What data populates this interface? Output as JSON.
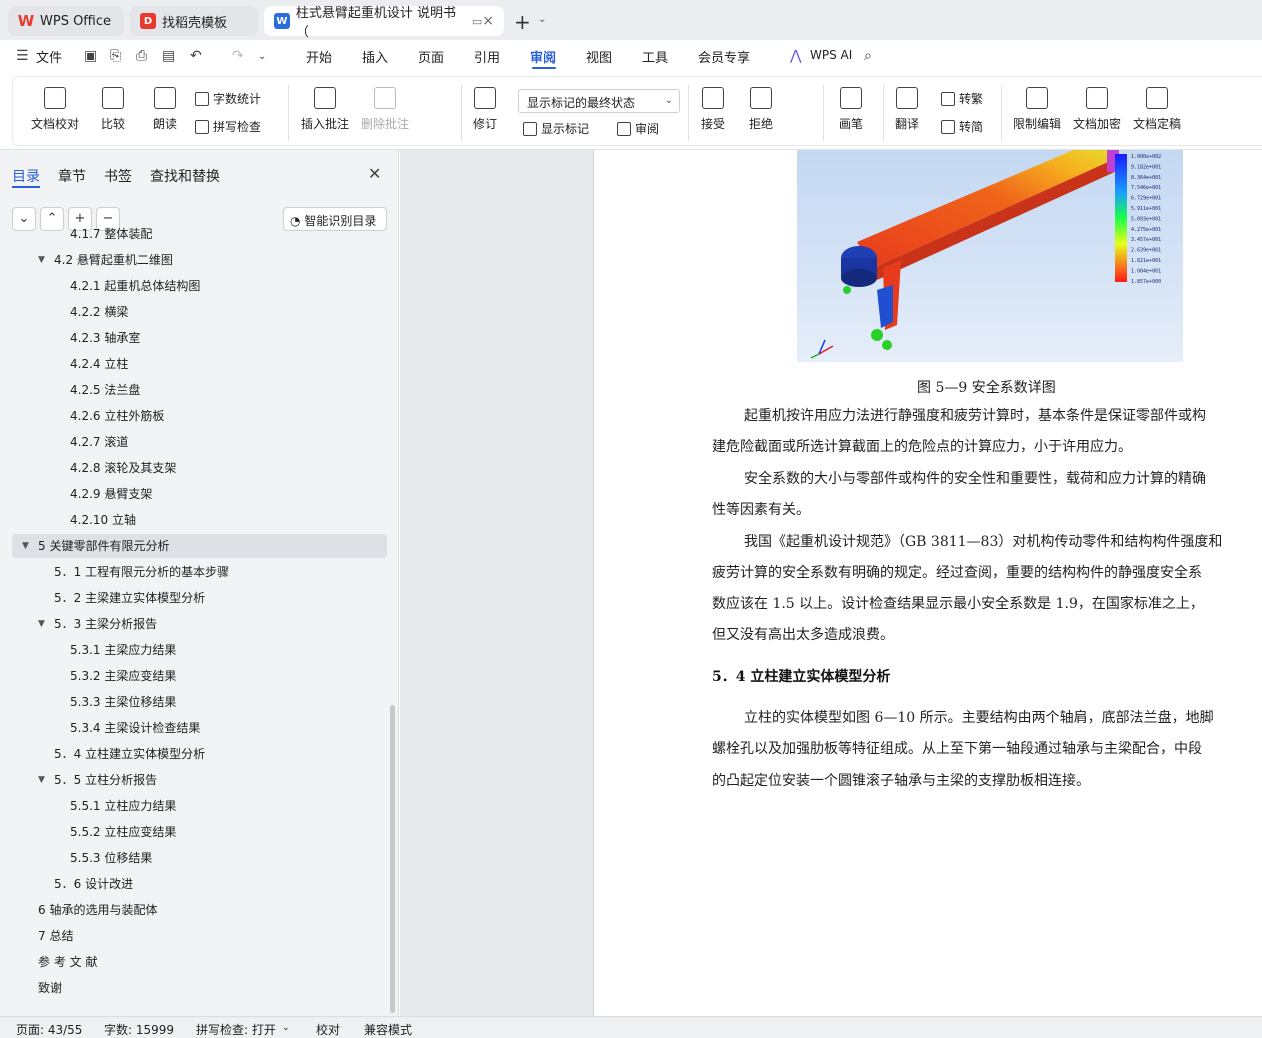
{
  "tabs": {
    "wps": "WPS Office",
    "templates": "找稻壳模板",
    "document": "柱式悬臂起重机设计 说明书（",
    "close": "×",
    "new_tab": "+"
  },
  "menu": {
    "file": "文件",
    "items": [
      "开始",
      "插入",
      "页面",
      "引用",
      "审阅",
      "视图",
      "工具",
      "会员专享"
    ],
    "active": "审阅",
    "wps_ai": "WPS AI"
  },
  "ribbon": {
    "proofread": "文档校对",
    "compare": "比较",
    "read_aloud": "朗读",
    "word_count": "字数统计",
    "spell_check": "拼写检查",
    "insert_comment": "插入批注",
    "delete_comment": "删除批注",
    "track": "修订",
    "markup_state": "显示标记的最终状态",
    "show_markup": "显示标记",
    "review": "审阅",
    "accept": "接受",
    "reject": "拒绝",
    "pen": "画笔",
    "translate": "翻译",
    "to_traditional": "转繁",
    "to_simplified": "转简",
    "restrict_edit": "限制编辑",
    "encrypt": "文档加密",
    "finalize": "文档定稿"
  },
  "sidebar": {
    "tabs": [
      "目录",
      "章节",
      "书签",
      "查找和替换"
    ],
    "smart_toc": "智能识别目录",
    "toc": [
      {
        "text": "4.1.7 整体装配",
        "indent": 3,
        "caret": false
      },
      {
        "text": "4.2   悬臂起重机二维图",
        "indent": 2,
        "caret": true
      },
      {
        "text": "4.2.1 起重机总体结构图",
        "indent": 3,
        "caret": false
      },
      {
        "text": "4.2.2 横梁",
        "indent": 3,
        "caret": false
      },
      {
        "text": "4.2.3 轴承室",
        "indent": 3,
        "caret": false
      },
      {
        "text": "4.2.4 立柱",
        "indent": 3,
        "caret": false
      },
      {
        "text": "4.2.5 法兰盘",
        "indent": 3,
        "caret": false
      },
      {
        "text": "4.2.6 立柱外筋板",
        "indent": 3,
        "caret": false
      },
      {
        "text": "4.2.7 滚道",
        "indent": 3,
        "caret": false
      },
      {
        "text": "4.2.8 滚轮及其支架",
        "indent": 3,
        "caret": false
      },
      {
        "text": "4.2.9 悬臂支架",
        "indent": 3,
        "caret": false
      },
      {
        "text": "4.2.10 立轴",
        "indent": 3,
        "caret": false
      },
      {
        "text": "5   关键零部件有限元分析",
        "indent": 1,
        "caret": true,
        "active": true
      },
      {
        "text": "5．1   工程有限元分析的基本步骤",
        "indent": 2,
        "caret": false
      },
      {
        "text": "5．2   主梁建立实体模型分析",
        "indent": 2,
        "caret": false
      },
      {
        "text": "5．3   主梁分析报告",
        "indent": 2,
        "caret": true
      },
      {
        "text": "5.3.1   主梁应力结果",
        "indent": 3,
        "caret": false
      },
      {
        "text": "5.3.2   主梁应变结果",
        "indent": 3,
        "caret": false
      },
      {
        "text": "5.3.3   主梁位移结果",
        "indent": 3,
        "caret": false
      },
      {
        "text": "5.3.4   主梁设计检查结果",
        "indent": 3,
        "caret": false
      },
      {
        "text": "5．4   立柱建立实体模型分析",
        "indent": 2,
        "caret": false
      },
      {
        "text": "5．5   立柱分析报告",
        "indent": 2,
        "caret": true
      },
      {
        "text": "5.5.1   立柱应力结果",
        "indent": 3,
        "caret": false
      },
      {
        "text": "5.5.2   立柱应变结果",
        "indent": 3,
        "caret": false
      },
      {
        "text": "5.5.3   位移结果",
        "indent": 3,
        "caret": false
      },
      {
        "text": "5．6   设计改进",
        "indent": 2,
        "caret": false
      },
      {
        "text": "6   轴承的选用与装配体",
        "indent": 1,
        "caret": false
      },
      {
        "text": "7   总结",
        "indent": 1,
        "caret": false
      },
      {
        "text": "参 考 文 献",
        "indent": 1,
        "caret": false
      },
      {
        "text": "致谢",
        "indent": 1,
        "caret": false
      }
    ]
  },
  "document": {
    "legend_values": [
      "1.000e+002",
      "9.182e+001",
      "8.364e+001",
      "7.546e+001",
      "6.729e+001",
      "5.911e+001",
      "5.093e+001",
      "4.275e+001",
      "3.457e+001",
      "2.639e+001",
      "1.821e+001",
      "1.004e+001",
      "1.857e+000"
    ],
    "caption": "图 5—9   安全系数详图",
    "para1_l1": "起重机按许用应力法进行静强度和疲劳计算时，基本条件是保证零部件或构",
    "para1_l2": "建危险截面或所选计算截面上的危险点的计算应力，小于许用应力。",
    "para2_l1": "安全系数的大小与零部件或构件的安全性和重要性，载荷和应力计算的精确",
    "para2_l2": "性等因素有关。",
    "para3_l1": "我国《起重机设计规范》（GB 3811—83）对机构传动零件和结构构件强度和",
    "para3_l2": "疲劳计算的安全系数有明确的规定。经过查阅，重要的结构构件的静强度安全系",
    "para3_l3": "数应该在 1.5 以上。设计检查结果显示最小安全系数是 1.9，在国家标准之上，",
    "para3_l4": "但又没有高出太多造成浪费。",
    "heading": "5．4   立柱建立实体模型分析",
    "para4_l1": "立柱的实体模型如图 6—10 所示。主要结构由两个轴肩，底部法兰盘，地脚",
    "para4_l2": "螺栓孔以及加强肋板等特征组成。从上至下第一轴段通过轴承与主梁配合，中段",
    "para4_l3": "的凸起定位安装一个圆锥滚子轴承与主梁的支撑肋板相连接。"
  },
  "status": {
    "page": "页面: 43/55",
    "words": "字数: 15999",
    "spell": "拼写检查: 打开",
    "proof": "校对",
    "compat": "兼容模式"
  }
}
